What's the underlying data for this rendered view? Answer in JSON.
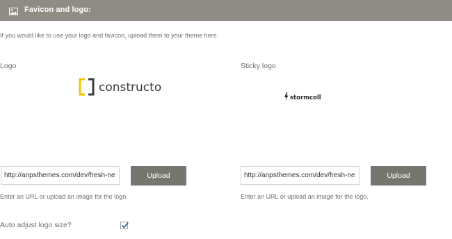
{
  "header": {
    "title": "Favicon and logo:",
    "icon": "image-icon"
  },
  "intro_text": "If you would like to use your logo and favicon, upload them to your theme here.",
  "logo": {
    "label": "Logo",
    "preview_brand": "constructo",
    "url_value": "http://anpsthemes.com/dev/fresh-ne",
    "upload_label": "Upload",
    "hint": "Enter an URL or upload an image for the logo.",
    "brand_colors": {
      "bracket_left": "#f2c500",
      "bracket_right": "#3a3a3a",
      "text": "#3a3a3a"
    }
  },
  "sticky_logo": {
    "label": "Sticky logo",
    "preview_brand": "stormcoll",
    "url_value": "http://anpsthemes.com/dev/fresh-ne",
    "upload_label": "Upload",
    "hint": "Enter an URL or upload an image for the logo."
  },
  "auto_adjust": {
    "label": "Auto adjust logo size?",
    "checked": true
  },
  "colors": {
    "header_bg": "#8e8c83",
    "button_bg": "#77766e",
    "checkmark": "#2e6da4"
  }
}
